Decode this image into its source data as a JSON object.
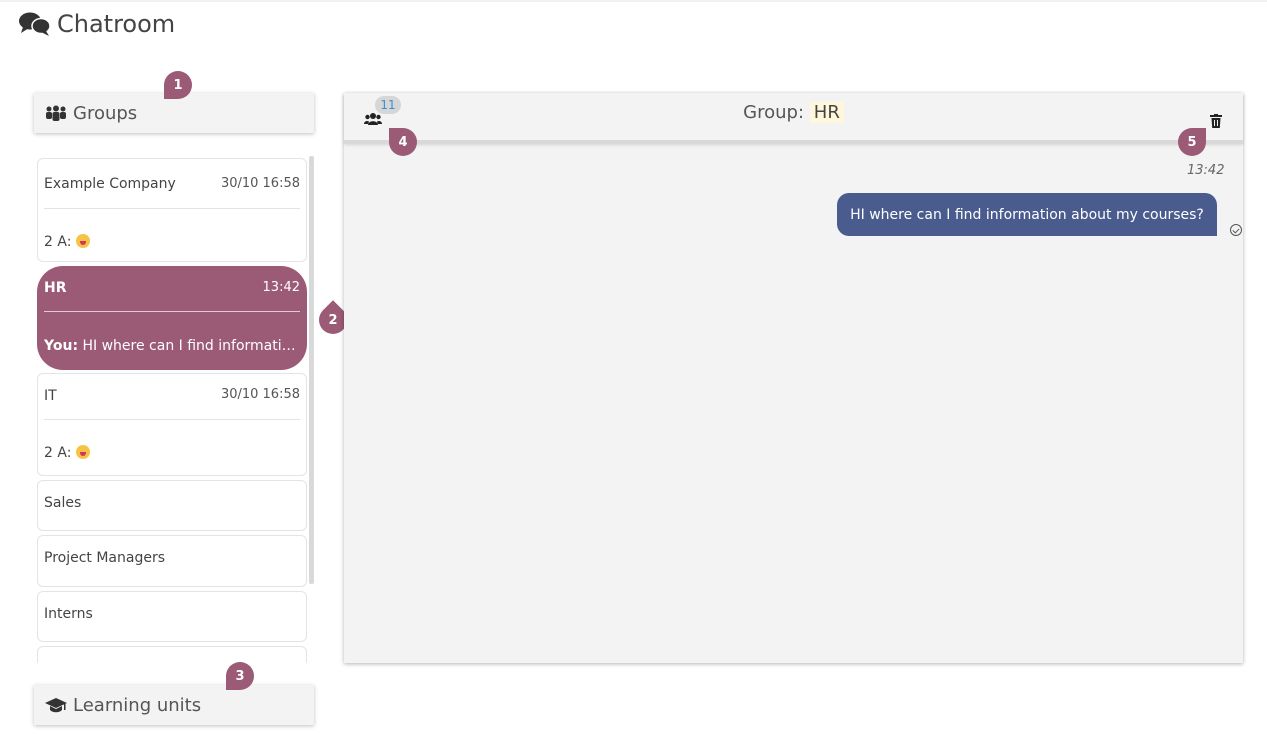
{
  "page": {
    "title": "Chatroom"
  },
  "groups_panel": {
    "title": "Groups"
  },
  "learning_panel": {
    "title": "Learning units"
  },
  "groups": [
    {
      "name": "Example Company",
      "time": "30/10 16:58",
      "last_sender": "2 A:",
      "last_message": "",
      "emoji": "grinning-tongue-emoji"
    },
    {
      "name": "HR",
      "time": "13:42",
      "last_sender": "You:",
      "last_message": " HI where can I find informatio...",
      "active": true
    },
    {
      "name": "IT",
      "time": "30/10 16:58",
      "last_sender": "2 A:",
      "last_message": "",
      "emoji": "winking-tongue-emoji"
    },
    {
      "name": "Sales"
    },
    {
      "name": "Project Managers"
    },
    {
      "name": "Interns"
    }
  ],
  "chat": {
    "title_prefix": "Group:",
    "group_name": "HR",
    "member_count": "11",
    "messages": [
      {
        "time": "13:42",
        "text": "HI where can I find information about my courses?"
      }
    ]
  },
  "callouts": [
    "1",
    "2",
    "3",
    "4",
    "5"
  ],
  "colors": {
    "accent": "#9b5a75",
    "bubble": "#4a5c8e",
    "panel": "#f3f3f3"
  }
}
